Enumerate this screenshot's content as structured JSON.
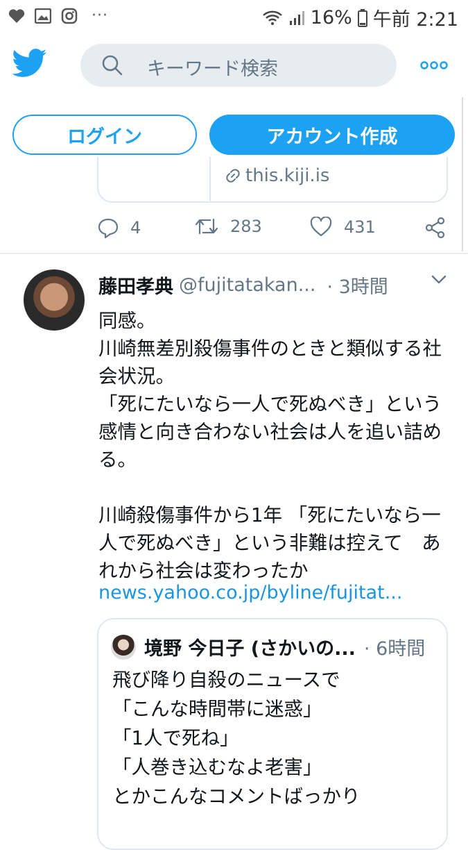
{
  "status_bar": {
    "battery": "16%",
    "time": "午前 2:21",
    "left_icons": [
      "heart-icon",
      "image-icon",
      "instagram-icon"
    ],
    "more": "···"
  },
  "header": {
    "search_placeholder": "キーワード検索"
  },
  "auth": {
    "login_label": "ログイン",
    "signup_label": "アカウント作成"
  },
  "prev_tweet": {
    "card_link": "this.kiji.is",
    "replies": "4",
    "retweets": "283",
    "likes": "431"
  },
  "tweet": {
    "name": "藤田孝典",
    "handle": "@fujitatakan...",
    "time": "· 3時間",
    "body": "同感。\n川崎無差別殺傷事件のときと類似する社会状況。\n「死にたいなら一人で死ぬべき」という感情と向き合わない社会は人を追い詰める。\n\n川崎殺傷事件から1年 「死にたいなら一人で死ぬべき」という非難は控えて　あれから社会は変わったか",
    "link": "news.yahoo.co.jp/byline/fujitat..."
  },
  "quote": {
    "name": "境野 今日子 (さかいの...",
    "time": "· 6時間",
    "body": "飛び降り自殺のニュースで\n「こんな時間帯に迷惑」\n「1人で死ね」\n「人巻き込むなよ老害」\nとかこんなコメントばっかり"
  },
  "colors": {
    "accent": "#1da1f2",
    "text": "#14171a",
    "muted": "#657786",
    "link": "#1b95e0",
    "border": "#e1e8ed"
  }
}
